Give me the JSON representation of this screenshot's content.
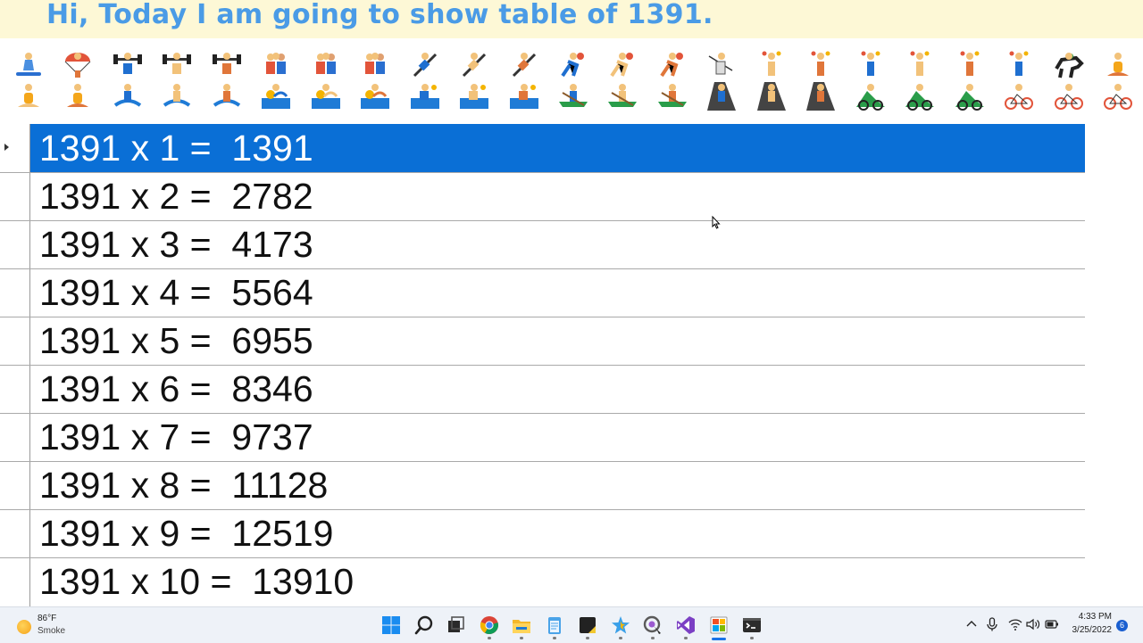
{
  "banner": {
    "title": "Hi, Today I am going to show table of 1391."
  },
  "table": {
    "rows": [
      {
        "text": "1391 x 1 =  1391"
      },
      {
        "text": "1391 x 2 =  2782"
      },
      {
        "text": "1391 x 3 =  4173"
      },
      {
        "text": "1391 x 4 =  5564"
      },
      {
        "text": "1391 x 5 =  6955"
      },
      {
        "text": "1391 x 6 =  8346"
      },
      {
        "text": "1391 x 7 =  9737"
      },
      {
        "text": "1391 x 8 =  11128"
      },
      {
        "text": "1391 x 9 =  12519"
      },
      {
        "text": "1391 x 10 =  13910"
      }
    ],
    "selected_row": 1
  },
  "emoji_strip": {
    "row1": [
      "snowboarder-icon",
      "parachute-person-icon",
      "weightlifter-icon",
      "weightlifter-icon",
      "weightlifter-icon",
      "wrestlers-icon",
      "wrestlers-icon",
      "wrestlers-icon",
      "cartwheel-icon",
      "cartwheel-icon",
      "cartwheel-icon",
      "handball-player-icon",
      "handball-player-icon",
      "handball-player-icon",
      "fencer-icon",
      "juggler-icon",
      "juggler-icon",
      "juggler-icon",
      "juggler-icon",
      "juggler-icon",
      "juggler-icon",
      "horse-racing-icon",
      "lotus-position-icon"
    ],
    "row2": [
      "lotus-position-icon",
      "lotus-position-icon",
      "surfer-icon",
      "surfer-icon",
      "surfer-icon",
      "swimmer-icon",
      "swimmer-icon",
      "swimmer-icon",
      "water-polo-icon",
      "water-polo-icon",
      "water-polo-icon",
      "rowboat-icon",
      "rowboat-icon",
      "rowboat-icon",
      "climber-icon",
      "climber-icon",
      "climber-icon",
      "mountain-biker-icon",
      "mountain-biker-icon",
      "mountain-biker-icon",
      "cyclist-icon",
      "cyclist-icon",
      "cyclist-icon"
    ]
  },
  "taskbar": {
    "weather": {
      "temp": "86°F",
      "condition": "Smoke"
    },
    "apps": [
      "start-icon",
      "search-icon",
      "task-view-icon",
      "chrome-icon",
      "file-explorer-icon",
      "notepad-icon",
      "sticky-app-icon",
      "paint-app-icon",
      "snipping-tool-icon",
      "visual-studio-icon",
      "windows-forms-app-icon",
      "terminal-icon"
    ],
    "clock": {
      "time": "4:33 PM",
      "date": "3/25/2022"
    },
    "notification_count": "6"
  },
  "colors": {
    "banner_bg": "#fdf8d6",
    "banner_text": "#4a9be6",
    "selection": "#0a6fd6",
    "taskbar_bg": "#eef2f8"
  }
}
